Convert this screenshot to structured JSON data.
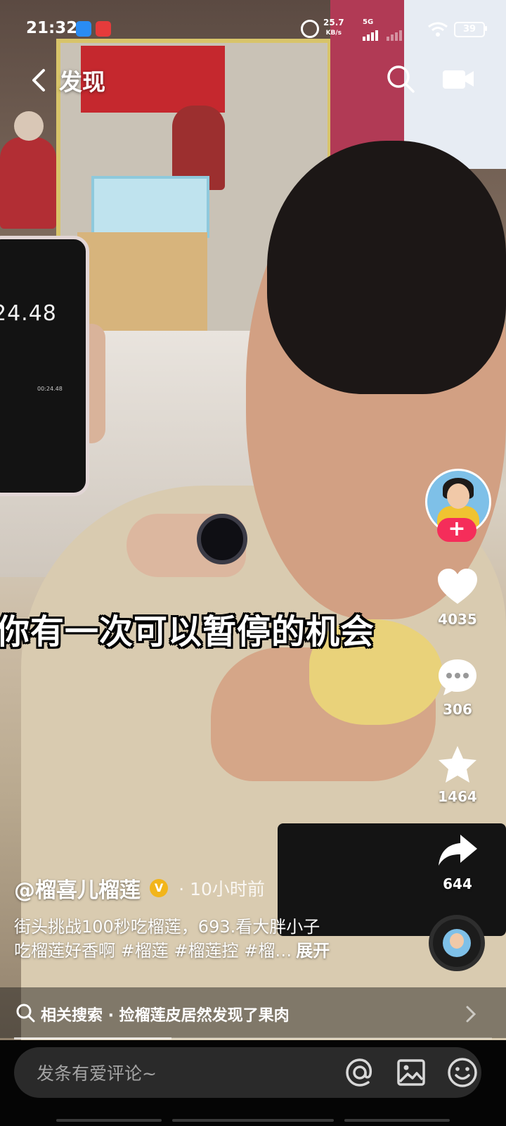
{
  "status_bar": {
    "time": "21:32",
    "network_speed": "25.7",
    "network_speed_unit": "KB/s",
    "network_type": "5G",
    "battery": "39"
  },
  "nav": {
    "title": "发现",
    "back_icon": "back-arrow-icon",
    "search_icon": "search-icon",
    "video_icon": "video-camera-icon"
  },
  "video": {
    "caption_overlay": "你有一次可以暂停的机会",
    "phone_stopwatch": "24.48",
    "phone_substopwatch": "00:24.48"
  },
  "sidebar": {
    "follow_label": "+",
    "likes": "4035",
    "comments": "306",
    "favorites": "1464",
    "shares": "644"
  },
  "post": {
    "author": "@榴喜儿榴莲",
    "verified_badge": "V",
    "time_ago": "· 10小时前",
    "description_line1": "街头挑战100秒吃榴莲，693.看大胖小子",
    "description_line2": "吃榴莲好香啊 #榴莲 #榴莲控 #榴…",
    "expand_label": "展开"
  },
  "related_search": {
    "label": "相关搜索 · 捡榴莲皮居然发现了果肉"
  },
  "progress": {
    "fraction": 0.33
  },
  "comment_bar": {
    "placeholder": "发条有爱评论~"
  },
  "colors": {
    "follow_button": "#f52d5a",
    "verified_badge": "#f2b51a",
    "bottom_bar": "#050505"
  }
}
